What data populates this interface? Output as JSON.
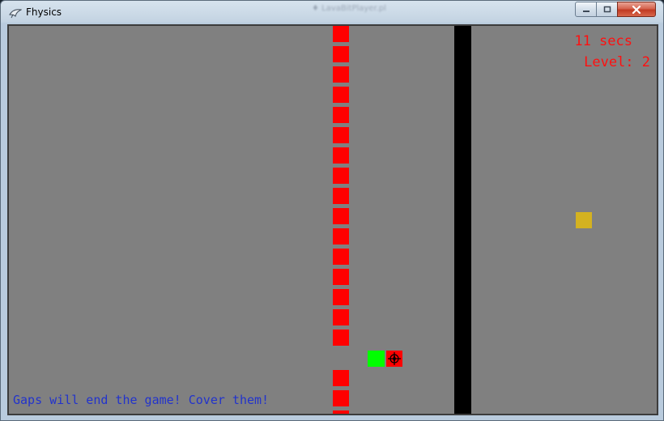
{
  "window": {
    "title": "Fhysics",
    "ghost_title": "♦ LavaBitPlayer.pl",
    "icon": "bird-app-icon",
    "controls": [
      "minimize-icon",
      "maximize-icon",
      "close-icon"
    ]
  },
  "hud": {
    "time": "11 secs",
    "level": "Level: 2"
  },
  "hint": "Gaps will end the game! Cover them!",
  "colors": {
    "background": "#808080",
    "block": "#ff0000",
    "wall": "#000000",
    "player": "#00ff00",
    "goal": "#d4b220",
    "hud_text": "#ff1010",
    "hint_text": "#2233cc"
  }
}
